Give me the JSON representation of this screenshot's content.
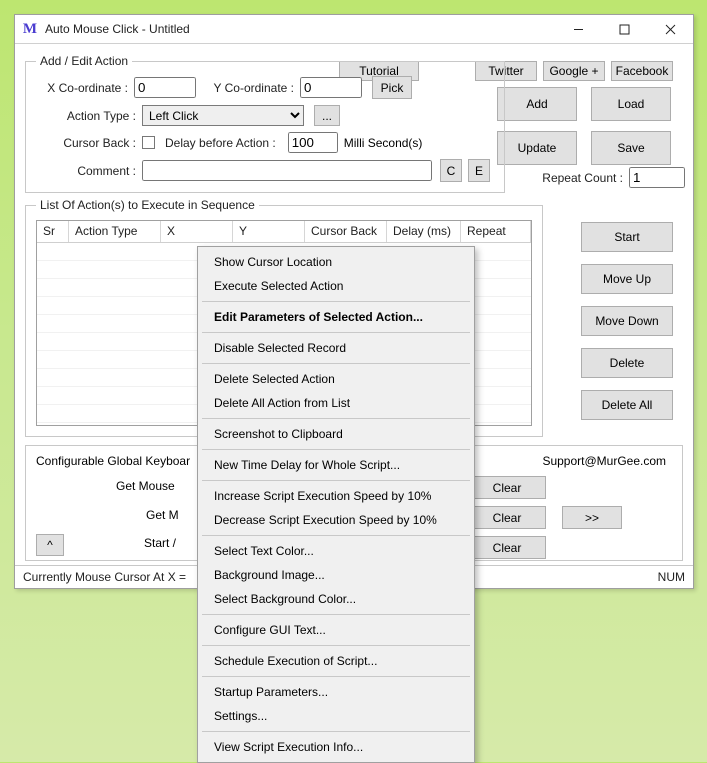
{
  "window": {
    "title": "Auto Mouse Click - Untitled"
  },
  "links": {
    "tutorial": "Tutorial",
    "twitter": "Twitter",
    "google": "Google +",
    "facebook": "Facebook"
  },
  "addedit": {
    "legend": "Add / Edit Action",
    "xcoord_label": "X Co-ordinate :",
    "xcoord_value": "0",
    "ycoord_label": "Y Co-ordinate :",
    "ycoord_value": "0",
    "pick": "Pick",
    "action_type_label": "Action Type :",
    "action_type_value": "Left Click",
    "dots": "...",
    "cursor_back_label": "Cursor Back :",
    "delay_label": "Delay before Action :",
    "delay_value": "100",
    "millis": "Milli Second(s)",
    "comment_label": "Comment :",
    "comment_value": "",
    "c_btn": "C",
    "e_btn": "E",
    "repeat_label": "Repeat Count :",
    "repeat_value": "1"
  },
  "bigbtns": {
    "add": "Add",
    "update": "Update",
    "load": "Load",
    "save": "Save"
  },
  "list": {
    "legend": "List Of Action(s) to Execute in Sequence",
    "cols": {
      "sr": "Sr",
      "atype": "Action Type",
      "x": "X",
      "y": "Y",
      "cursor": "Cursor Back",
      "delay": "Delay (ms)",
      "repeat": "Repeat"
    }
  },
  "sidebtns": {
    "start": "Start",
    "moveup": "Move Up",
    "movedown": "Move Down",
    "delete": "Delete",
    "deleteall": "Delete All"
  },
  "lower": {
    "cfg_label": "Configurable Global Keyboar",
    "get_mouse": "Get Mouse",
    "get_m": "Get M",
    "start_s": "Start / ",
    "support": "Support@MurGee.com",
    "clear": "Clear",
    "chev": ">>",
    "chevup": "^"
  },
  "status": {
    "left": "Currently Mouse Cursor At X =",
    "right": "NUM"
  },
  "menu": {
    "i0": "Show Cursor Location",
    "i1": "Execute Selected Action",
    "i2": "Edit Parameters of Selected Action...",
    "i3": "Disable Selected Record",
    "i4": "Delete Selected Action",
    "i5": "Delete All Action from List",
    "i6": "Screenshot to Clipboard",
    "i7": "New Time Delay for Whole Script...",
    "i8": "Increase Script Execution Speed by 10%",
    "i9": "Decrease Script Execution Speed by 10%",
    "i10": "Select Text Color...",
    "i11": "Background Image...",
    "i12": "Select Background Color...",
    "i13": "Configure GUI Text...",
    "i14": "Schedule Execution of Script...",
    "i15": "Startup Parameters...",
    "i16": "Settings...",
    "i17": "View Script Execution Info..."
  }
}
